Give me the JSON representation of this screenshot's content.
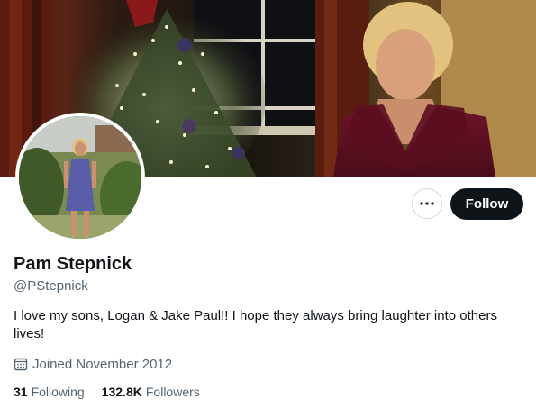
{
  "profile": {
    "name": "Pam Stepnick",
    "handle": "@PStepnick",
    "bio": "I love my sons, Logan & Jake Paul!! I hope they always bring laughter into others lives!",
    "joined": "Joined November 2012",
    "following_count": "31",
    "following_label": "Following",
    "followers_count": "132.8K",
    "followers_label": "Followers"
  },
  "actions": {
    "follow_label": "Follow",
    "more_icon": "more-horizontal-icon"
  },
  "icons": {
    "joined": "calendar-icon"
  },
  "colors": {
    "primary_text": "#0f1419",
    "secondary_text": "#536471",
    "follow_button_bg": "#0f1419",
    "border": "#cfd9de"
  }
}
